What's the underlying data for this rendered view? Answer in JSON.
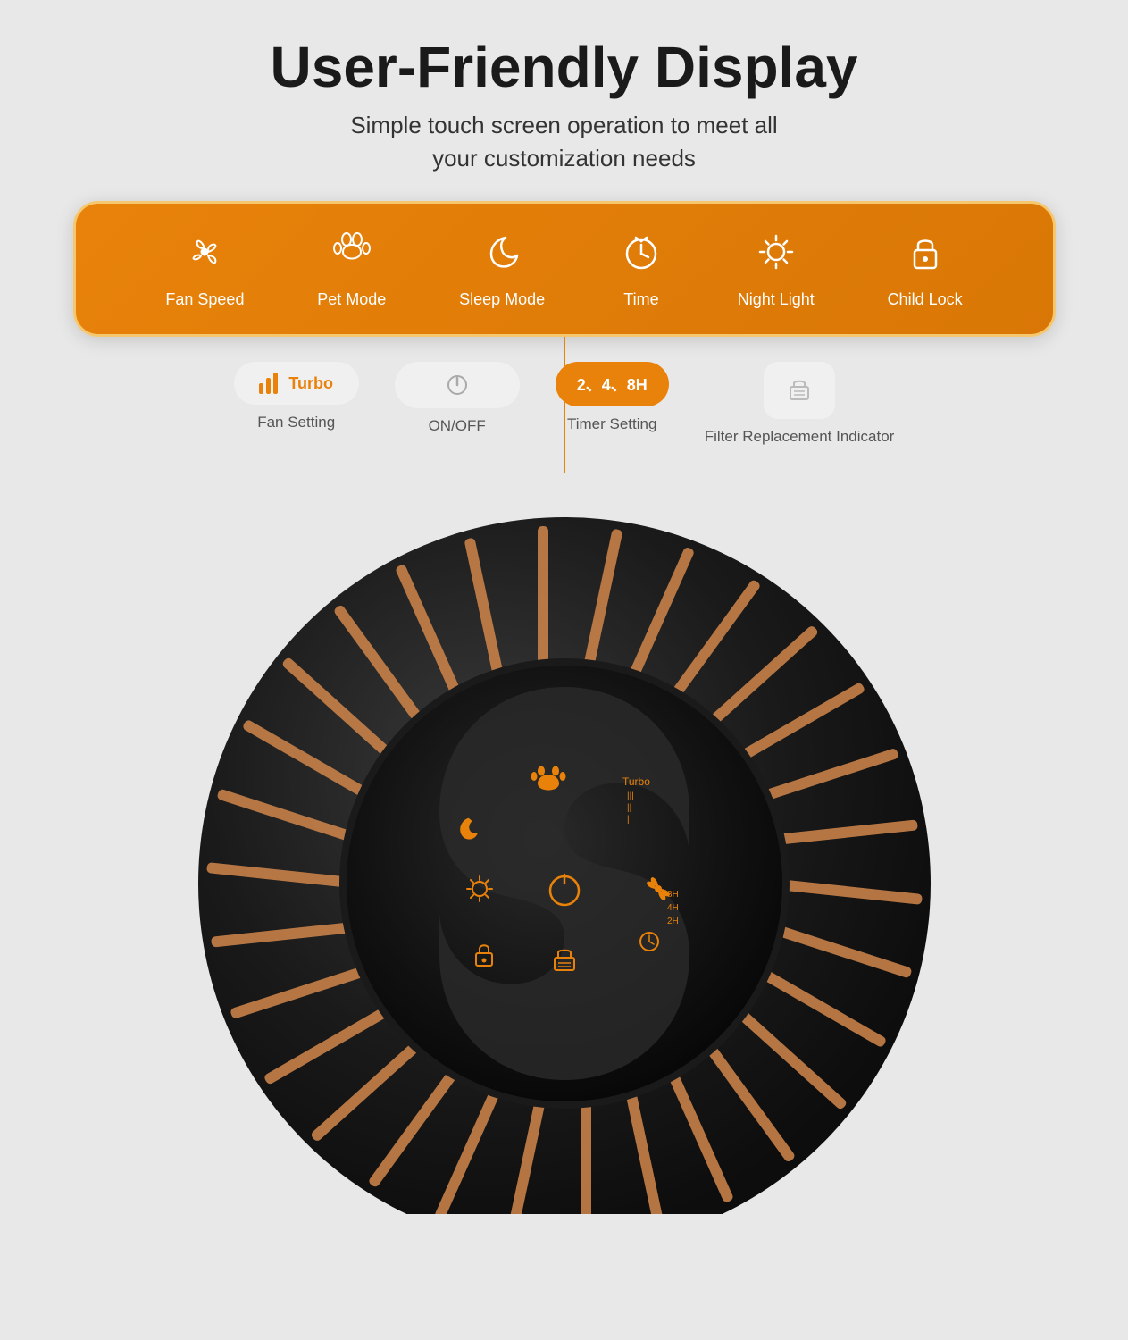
{
  "header": {
    "title": "User-Friendly Display",
    "subtitle": "Simple touch screen operation to meet all\nyour customization needs"
  },
  "features": [
    {
      "id": "fan-speed",
      "label": "Fan Speed",
      "icon": "✦",
      "unicode": "fan"
    },
    {
      "id": "pet-mode",
      "label": "Pet Mode",
      "icon": "🐾",
      "unicode": "paw"
    },
    {
      "id": "sleep-mode",
      "label": "Sleep Mode",
      "icon": "☾",
      "unicode": "moon"
    },
    {
      "id": "time",
      "label": "Time",
      "icon": "⏱",
      "unicode": "timer"
    },
    {
      "id": "night-light",
      "label": "Night Light",
      "icon": "✦",
      "unicode": "sun"
    },
    {
      "id": "child-lock",
      "label": "Child Lock",
      "icon": "🔒",
      "unicode": "lock"
    }
  ],
  "controls": [
    {
      "id": "fan-setting",
      "label": "Fan Setting",
      "type": "bars-turbo"
    },
    {
      "id": "on-off",
      "label": "ON/OFF",
      "type": "power"
    },
    {
      "id": "timer-setting",
      "label": "Timer Setting",
      "type": "timer",
      "value": "2、4、8H"
    },
    {
      "id": "filter-indicator",
      "label": "Filter Replacement Indicator",
      "type": "filter"
    }
  ]
}
